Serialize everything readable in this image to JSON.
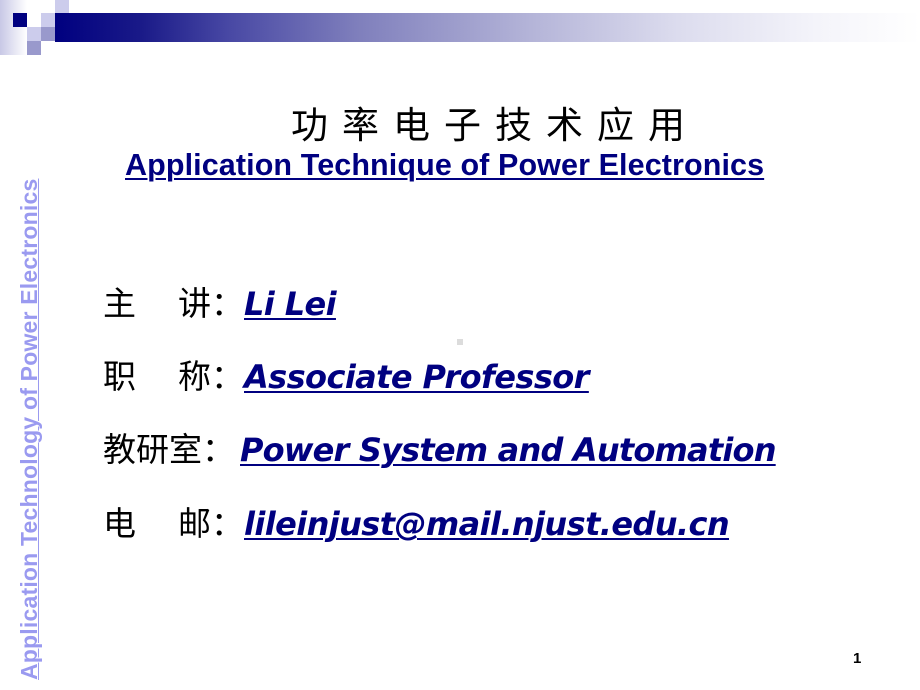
{
  "slide": {
    "side_title": "Application Technology of Power Electronics",
    "title_cn": "功率电子技术应用",
    "title_en": "Application Technique of Power Electronics",
    "info": [
      {
        "label_a": "主",
        "label_b": "讲",
        "colon": "：",
        "value": "Li Lei"
      },
      {
        "label_a": "职",
        "label_b": "称",
        "colon": "：",
        "value": "Associate Professor"
      },
      {
        "label": "教研室",
        "colon": "：",
        "value": "Power System and Automation"
      },
      {
        "label_a": "电",
        "label_b": "邮",
        "colon": "：",
        "value": "lileinjust@mail.njust.edu.cn"
      }
    ],
    "page_number": "1"
  },
  "theme": {
    "accent": "#000080",
    "side_title_color": "#9a9af0"
  }
}
